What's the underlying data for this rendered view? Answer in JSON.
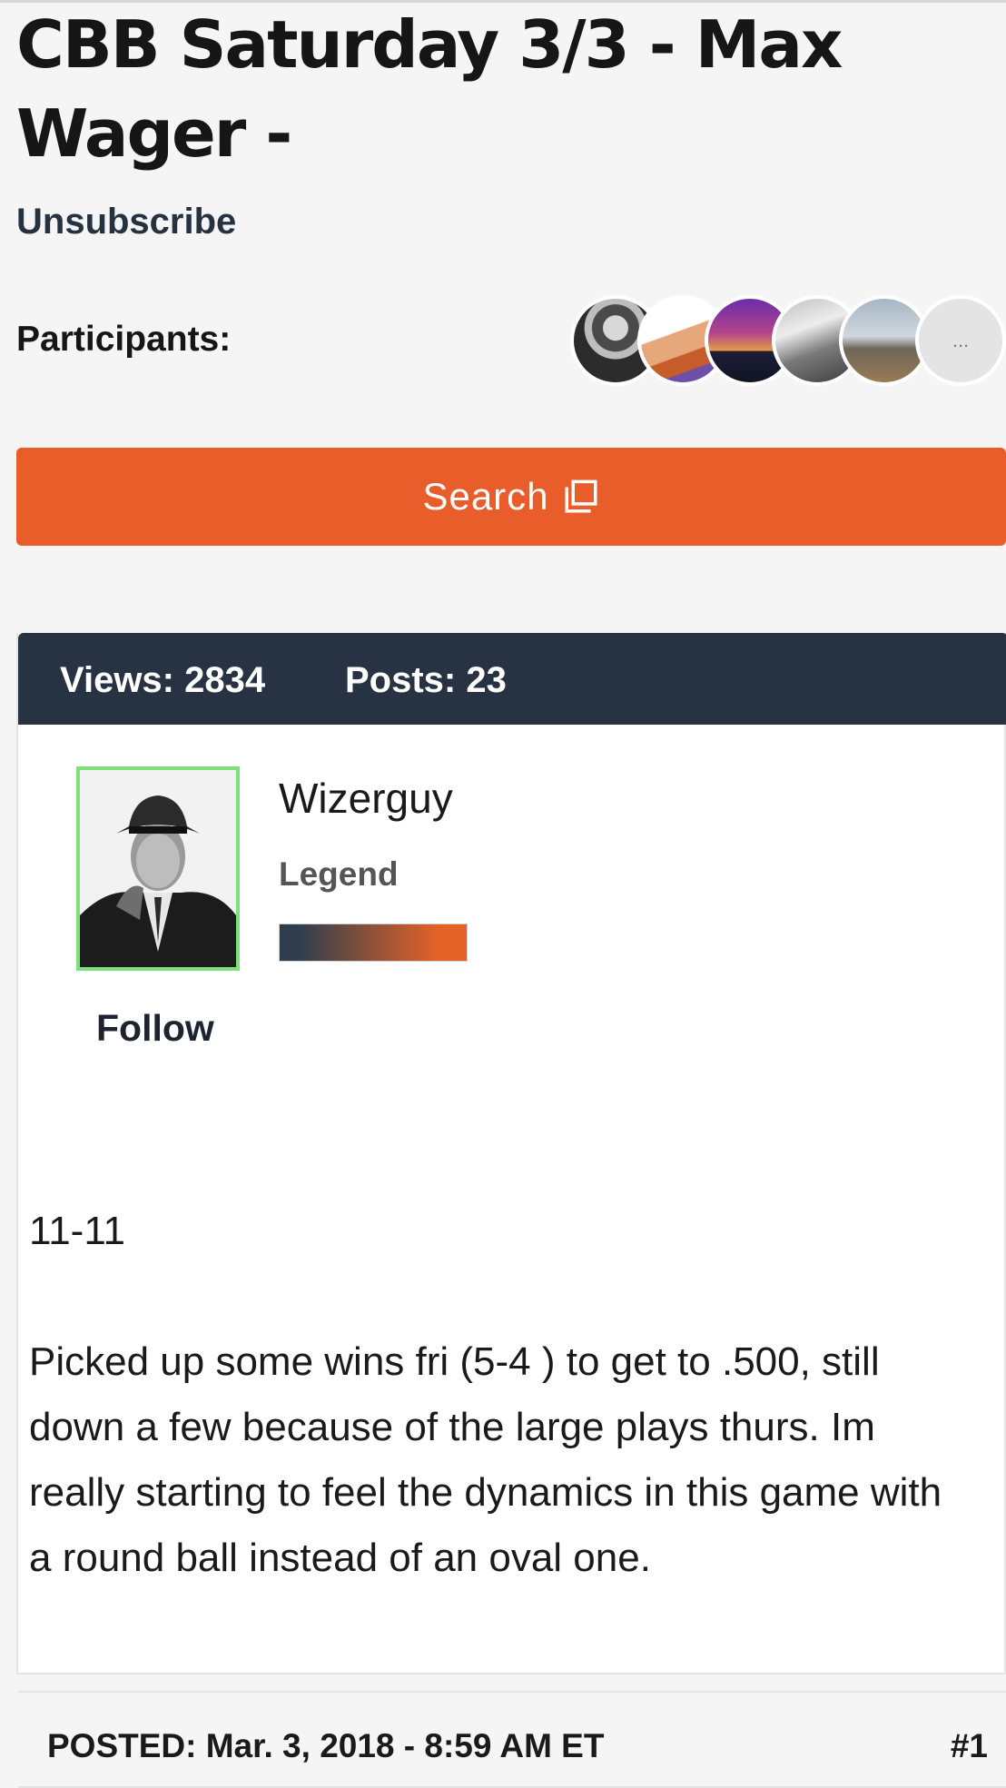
{
  "thread": {
    "title": "CBB Saturday 3/3 - Max Wager -",
    "unsubscribe_label": "Unsubscribe",
    "participants_label": "Participants:",
    "participants_more": "..."
  },
  "search": {
    "label": "Search"
  },
  "stats": {
    "views": "Views: 2834",
    "posts": "Posts: 23"
  },
  "post": {
    "username": "Wizerguy",
    "rank": "Legend",
    "follow_label": "Follow",
    "posted": "POSTED: Mar. 3, 2018 - 8:59 AM ET",
    "number": "#1",
    "body_line1": "11-11",
    "body_paragraph": "Picked up some wins fri (5-4 ) to get to .500, still down a few because of the large plays thurs. Im really starting to feel the dynamics in this game with a round ball instead of an oval one."
  },
  "colors": {
    "accent": "#e95d2b",
    "header_bg": "#273342",
    "avatar_border": "#7ee07a"
  }
}
